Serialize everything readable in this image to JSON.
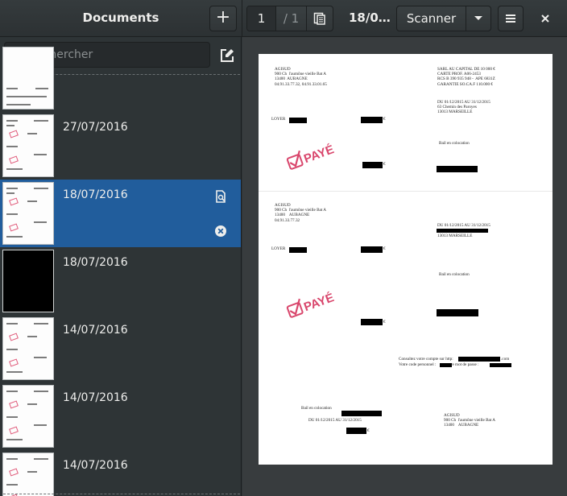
{
  "header": {
    "sidebar_title": "Documents",
    "current_page": "1",
    "total_pages": "/ 1",
    "document_title": "18/0…",
    "scanner_label": "Scanner"
  },
  "sidebar": {
    "search_placeholder": "Rechercher",
    "documents": [
      {
        "date": ""
      },
      {
        "date": "27/07/2016"
      },
      {
        "date": "18/07/2016",
        "selected": true
      },
      {
        "date": "18/07/2016",
        "black": true
      },
      {
        "date": "14/07/2016"
      },
      {
        "date": "14/07/2016"
      },
      {
        "date": "14/07/2016"
      }
    ]
  },
  "page": {
    "sender_top": "AGISUD\n900 Ch  l'aumône vieille Bat A\n13400  AUBAGNE\n04.91.33.77.32, 04.91.33.01.65",
    "company_info": "SARL AU CAPITAL DE 10 000 €\nCARTE PROF. A06-2453\nRCS B 390 935 948 -  APE 6831Z\nGARANTIE SO.CA.F 110.000 €",
    "period_top": "DU 01/12/2015 AU 31/12/2015\n63 Chemin des Paroyes\n13013 MARSEILLE",
    "loyer_label_1": "LOYER",
    "euro_1": "€",
    "bail_1": "Bail en colocation",
    "euro_2": "€",
    "stamp_text": "PAYÉ",
    "sender_mid": "AGISUD\n900 Ch  l'aumône vieille Bat A\n13400    AUBAGNE\n04.91.33.77.32",
    "period_mid": "DU 01/12/2015 AU 31/12/2015",
    "city_mid": "13013 MARSEILLE",
    "loyer_label_2": "LOYER",
    "euro_3": "€",
    "bail_2": "Bail en colocation",
    "euro_4": "€",
    "consult_line": "Consultez votre compte sur http:",
    "consult_suffix": ".com",
    "code_line": "Votre code personnel :         votre mot de passe :",
    "bail_3": "Bail en colocation",
    "period_bottom": "DU 01/12/2015 AU 31/12/2015",
    "euro_5": "€",
    "sender_bottom": "AGISUD\n900 Ch  l'aumône vieille Bat A\n13400    AUBAGNE"
  },
  "colors": {
    "accent": "#215d9c",
    "stamp": "#d9466c",
    "background": "#2e3436"
  }
}
